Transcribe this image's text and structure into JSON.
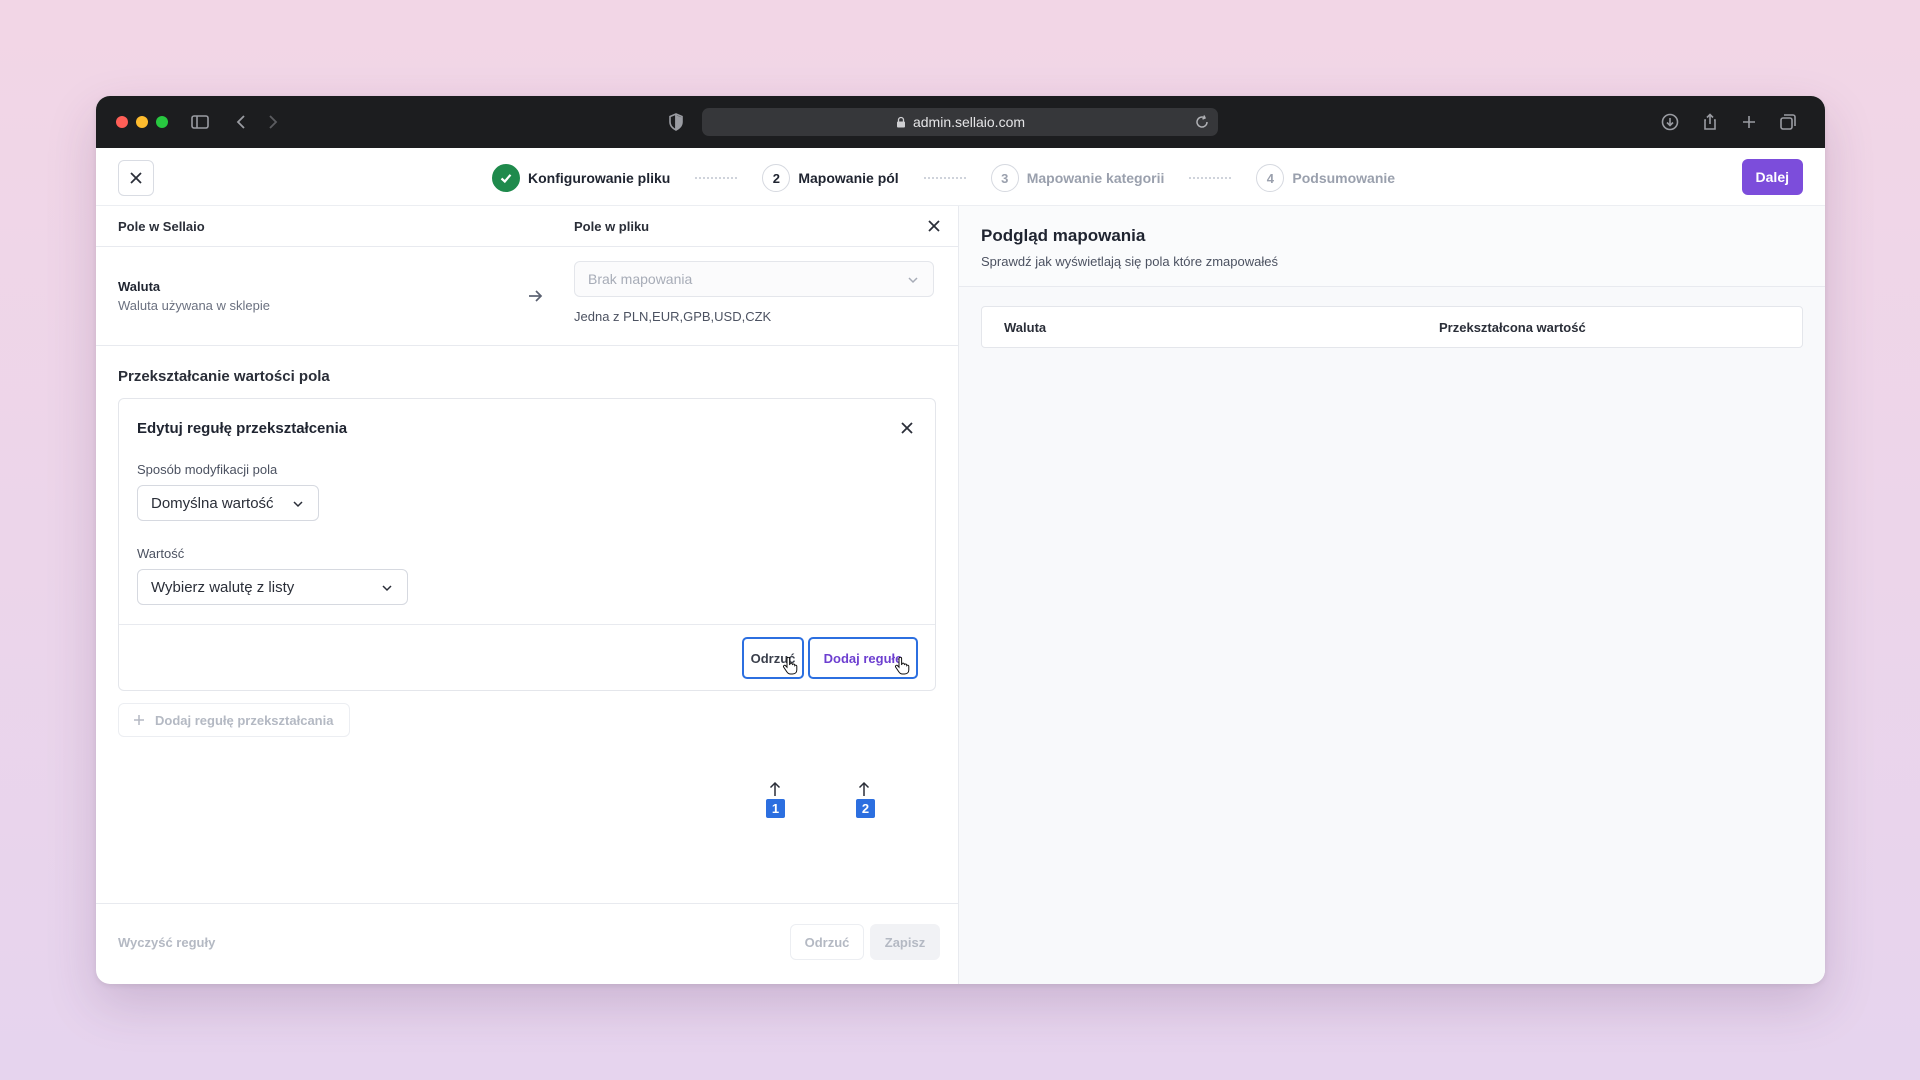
{
  "browser": {
    "url": "admin.sellaio.com"
  },
  "header": {
    "steps": [
      {
        "number": "1",
        "label": "Konfigurowanie pliku",
        "state": "done"
      },
      {
        "number": "2",
        "label": "Mapowanie pól",
        "state": "active"
      },
      {
        "number": "3",
        "label": "Mapowanie kategorii",
        "state": "pending"
      },
      {
        "number": "4",
        "label": "Podsumowanie",
        "state": "pending"
      }
    ],
    "next_label": "Dalej"
  },
  "mapping": {
    "col_sellaio": "Pole w Sellaio",
    "col_file": "Pole w pliku",
    "field_name": "Waluta",
    "field_desc": "Waluta używana w sklepie",
    "file_placeholder": "Brak mapowania",
    "file_hint": "Jedna z PLN,EUR,GPB,USD,CZK"
  },
  "transform": {
    "section_title": "Przekształcanie wartości pola",
    "card_title": "Edytuj regułę przekształcenia",
    "mode_label": "Sposób modyfikacji pola",
    "mode_value": "Domyślna wartość",
    "value_label": "Wartość",
    "value_placeholder": "Wybierz walutę z listy",
    "discard_label": "Odrzuć",
    "add_label": "Dodaj regułę",
    "marker_1": "1",
    "marker_2": "2",
    "add_rule_label": "Dodaj regułę przekształcania"
  },
  "footer": {
    "clear_label": "Wyczyść reguły",
    "discard_label": "Odrzuć",
    "save_label": "Zapisz"
  },
  "preview": {
    "title": "Podgląd mapowania",
    "subtitle": "Sprawdź jak wyświetlają się pola które zmapowałeś",
    "col_1": "Waluta",
    "col_2": "Przekształcona wartość"
  },
  "colors": {
    "accent": "#7c4ddb",
    "done": "#1f8a4c",
    "highlight": "#2c6fe0"
  }
}
